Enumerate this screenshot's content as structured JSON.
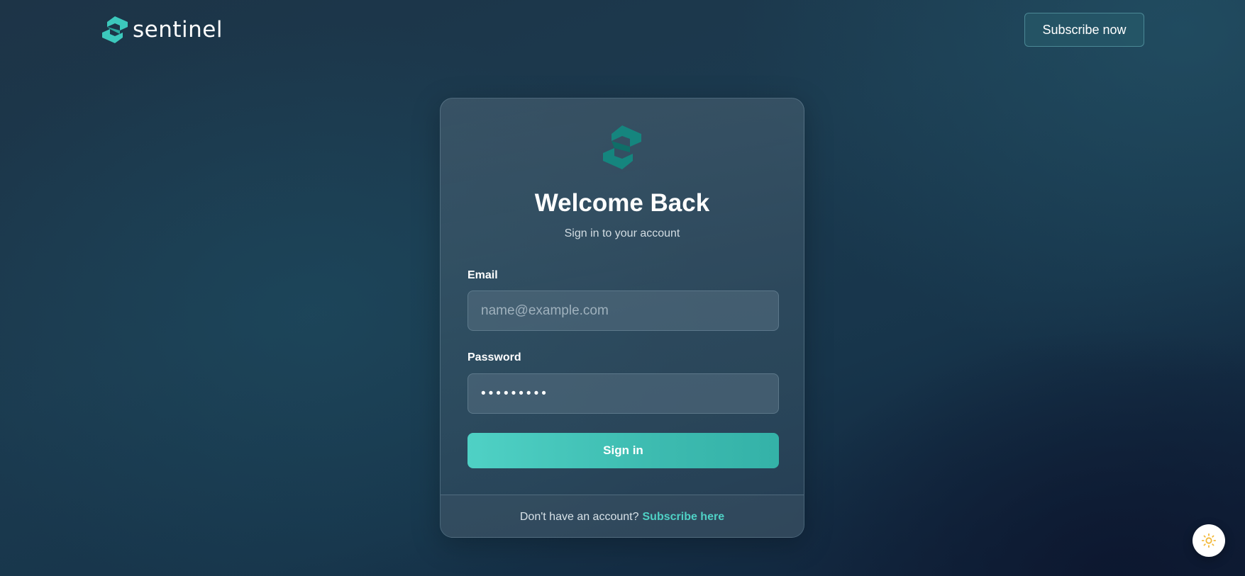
{
  "brand": {
    "name": "sentinel",
    "logo_icon": "sentinel-s-logo-icon",
    "accent_color": "#4fd1c5",
    "logo_color": "#3cc8bc"
  },
  "header": {
    "subscribe_label": "Subscribe now"
  },
  "login_card": {
    "logo_icon": "sentinel-s-logo-icon",
    "title": "Welcome Back",
    "subtitle": "Sign in to your account",
    "email": {
      "label": "Email",
      "placeholder": "name@example.com",
      "value": ""
    },
    "password": {
      "label": "Password",
      "value": "•••••••••"
    },
    "signin_label": "Sign in",
    "footer": {
      "prompt": "Don't have an account?",
      "link_label": "Subscribe here"
    }
  },
  "theme_toggle": {
    "icon": "sun-icon",
    "icon_color": "#f2b93b"
  }
}
